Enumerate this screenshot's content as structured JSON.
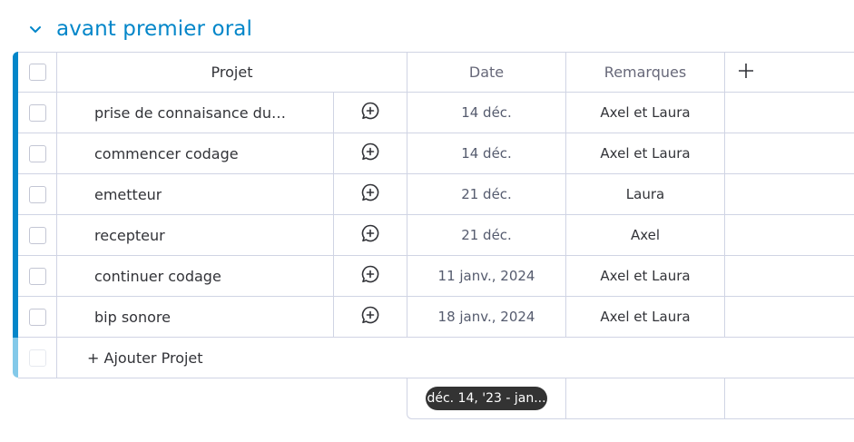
{
  "group": {
    "title": "avant premier oral",
    "color": "#0386c9"
  },
  "columns": {
    "name": "Projet",
    "date": "Date",
    "remarks": "Remarques",
    "add_icon": "plus-icon"
  },
  "rows": [
    {
      "name": "prise de connaisance du ...",
      "date": "14 déc.",
      "remarks": "Axel et Laura"
    },
    {
      "name": "commencer codage",
      "date": "14 déc.",
      "remarks": "Axel et Laura"
    },
    {
      "name": "emetteur",
      "date": "21 déc.",
      "remarks": "Laura"
    },
    {
      "name": "recepteur",
      "date": "21 déc.",
      "remarks": "Axel"
    },
    {
      "name": "continuer codage",
      "date": "11 janv., 2024",
      "remarks": "Axel et Laura"
    },
    {
      "name": "bip sonore",
      "date": "18 janv., 2024",
      "remarks": "Axel et Laura"
    }
  ],
  "add_item": {
    "label": "+ Ajouter Projet"
  },
  "summary": {
    "timeline": "déc. 14, '23 - jan..."
  }
}
